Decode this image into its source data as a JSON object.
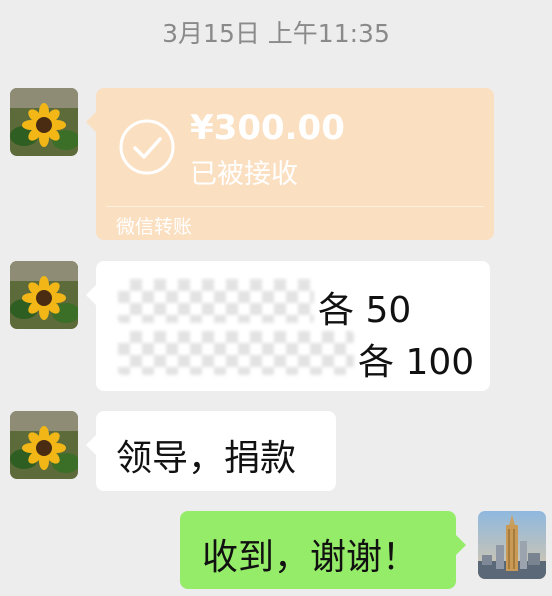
{
  "chat": {
    "timestamp": "3月15日 上午11:35",
    "transfer": {
      "amount": "¥300.00",
      "status": "已被接收",
      "caption": "微信转账",
      "icon": "check-circle-icon"
    },
    "redacted_message": {
      "line1_suffix": "各 50",
      "line2_suffix": "各 100"
    },
    "message_donation": "领导，捐款",
    "reply": "收到，谢谢！",
    "colors": {
      "transfer_bg": "#fbdfc1",
      "my_bubble": "#95ec69",
      "their_bubble": "#ffffff",
      "background": "#ededed"
    }
  }
}
